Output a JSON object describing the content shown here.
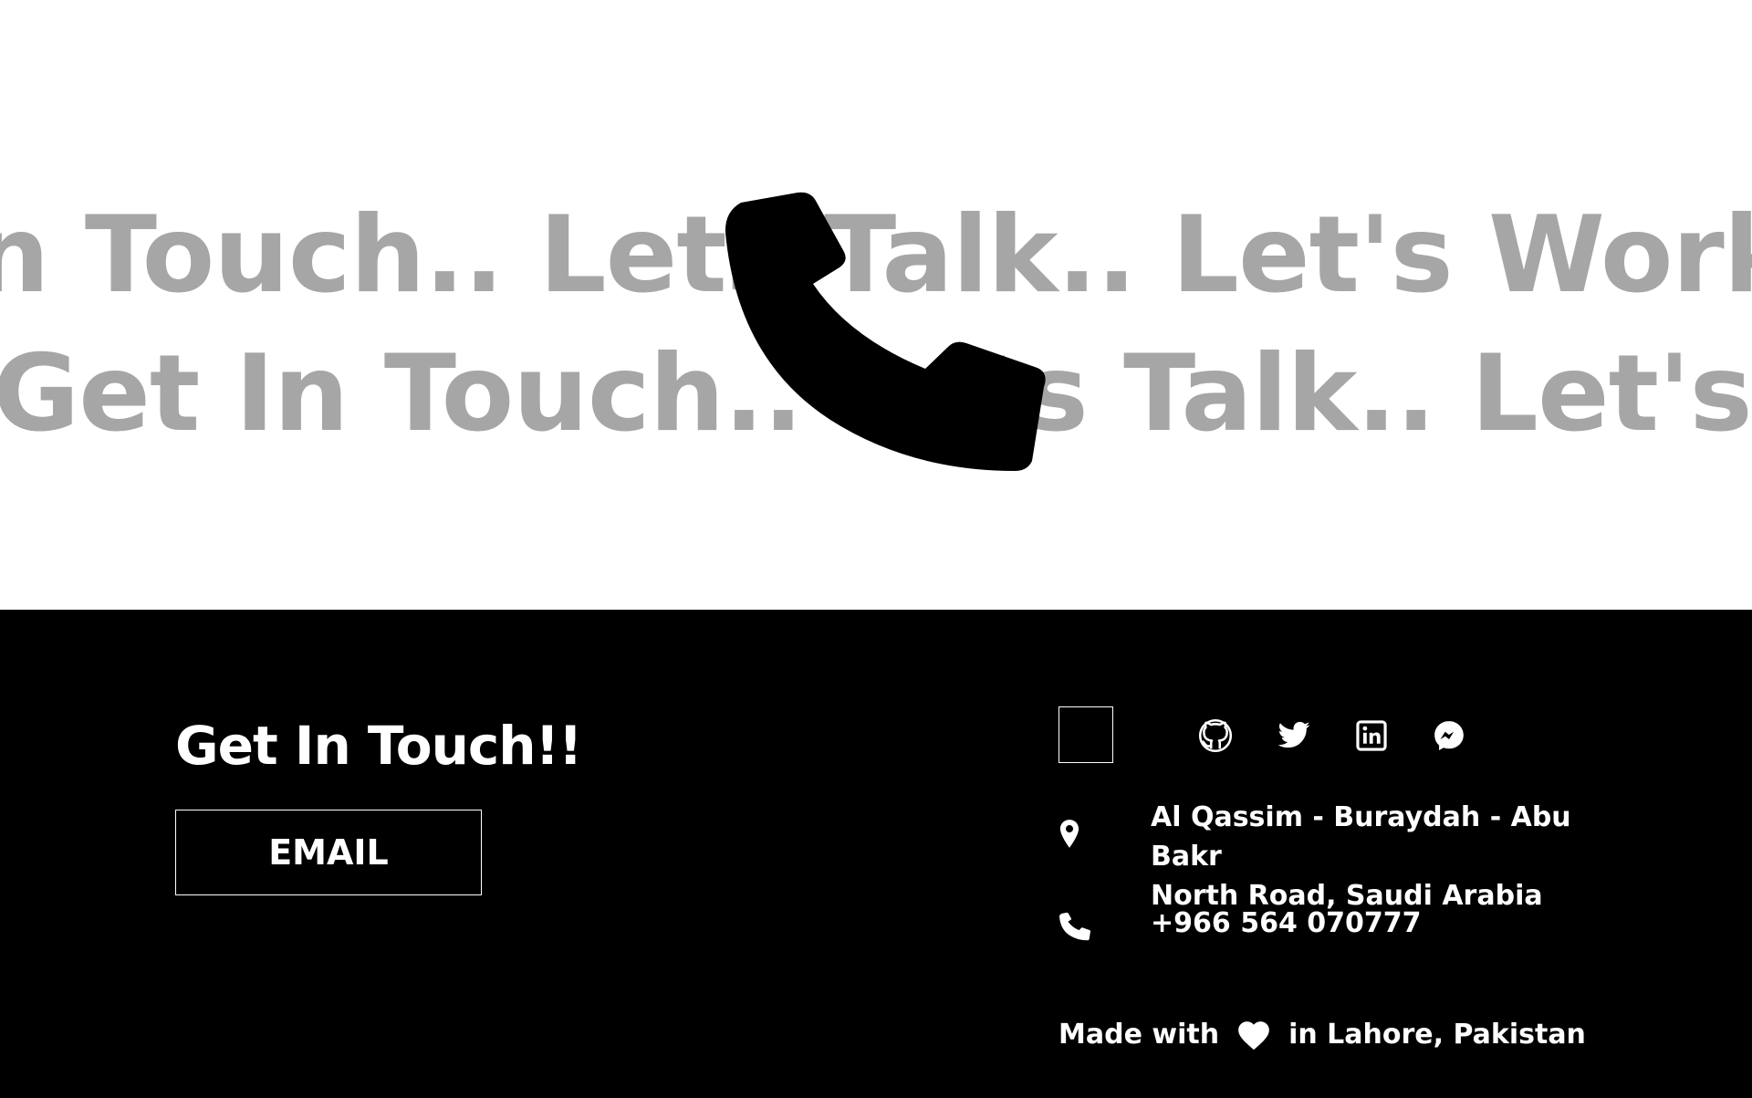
{
  "hero": {
    "marquee_line_1": "Get In Touch.. Lets Talk.. Let's Work Together.. Get In Touch.. Lets Talk.. Let's Work Together..",
    "marquee_line_2": "Get In Touch.. Lets Talk.. Let's Work Together.. Get In Touch.. Lets Talk..",
    "icon": "phone-icon",
    "text_color": "#a6a6a6"
  },
  "footer": {
    "title": "Get In Touch!!",
    "email_button_label": "EMAIL",
    "social": [
      {
        "name": "github-icon"
      },
      {
        "name": "twitter-icon"
      },
      {
        "name": "linkedin-icon"
      },
      {
        "name": "messenger-icon"
      }
    ],
    "address_line_1": "Al Qassim - Buraydah - Abu Bakr",
    "address_line_2": "North Road, Saudi Arabia",
    "phone": "+966 564 070777",
    "made_with_prefix": "Made with",
    "made_with_suffix": "in Lahore, Pakistan",
    "background": "#000000",
    "foreground": "#ffffff"
  }
}
